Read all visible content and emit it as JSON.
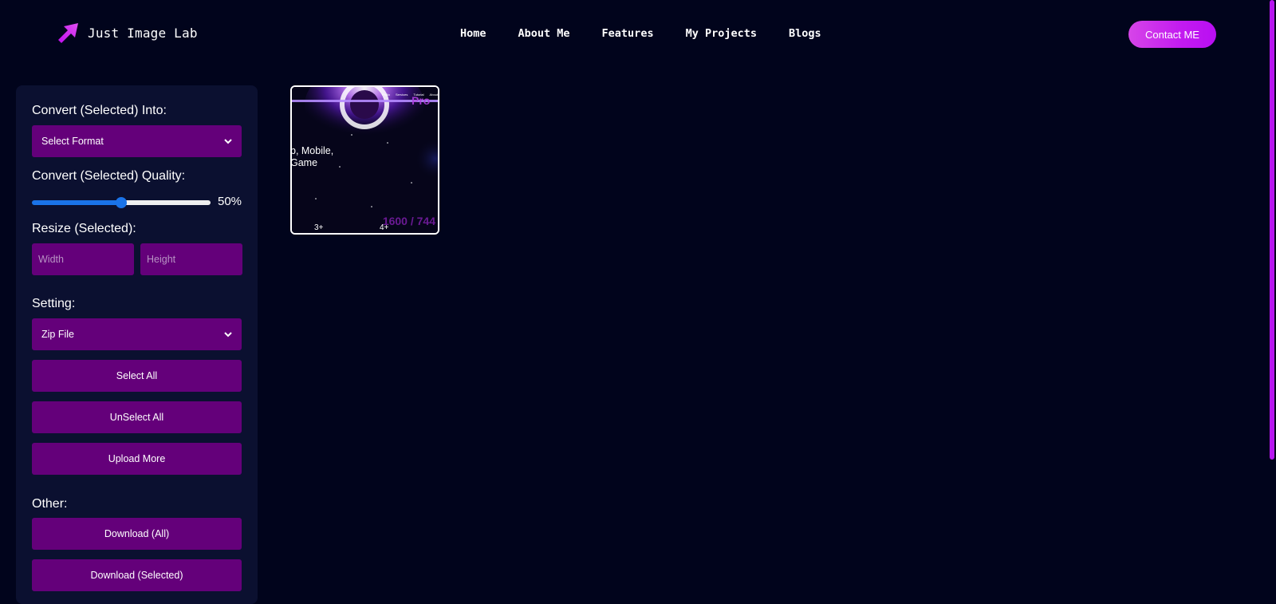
{
  "header": {
    "brand": "Just Image Lab",
    "nav": [
      "Home",
      "About Me",
      "Features",
      "My Projects",
      "Blogs"
    ],
    "contact_label": "Contact ME"
  },
  "sidebar": {
    "convert_into_label": "Convert (Selected) Into:",
    "format_select_value": "Select Format",
    "quality_label": "Convert (Selected) Quality:",
    "quality_value": 50,
    "quality_display": "50%",
    "resize_label": "Resize (Selected):",
    "width_placeholder": "Width",
    "height_placeholder": "Height",
    "setting_label": "Setting:",
    "setting_select_value": "Zip File",
    "select_all": "Select All",
    "unselect_all": "UnSelect All",
    "upload_more": "Upload More",
    "other_label": "Other:",
    "download_all": "Download (All)",
    "download_selected": "Download (Selected)"
  },
  "gallery": {
    "items": [
      {
        "text_line_1": "b, Mobile,",
        "text_line_2": "Game",
        "resolution": "1600 / 744",
        "badge_1": "3+",
        "badge_2": "4+",
        "mini_nav": [
          "Pfolio",
          "Services",
          "Tutorial",
          "About"
        ]
      }
    ]
  },
  "colors": {
    "background": "#01041c",
    "sidebar": "#0b1030",
    "control": "#64007a",
    "accent": "#b716f0",
    "slider": "#1a73e8"
  },
  "icons": {
    "brand": "arrow-cursor-icon",
    "select": "chevron-down-icon"
  }
}
